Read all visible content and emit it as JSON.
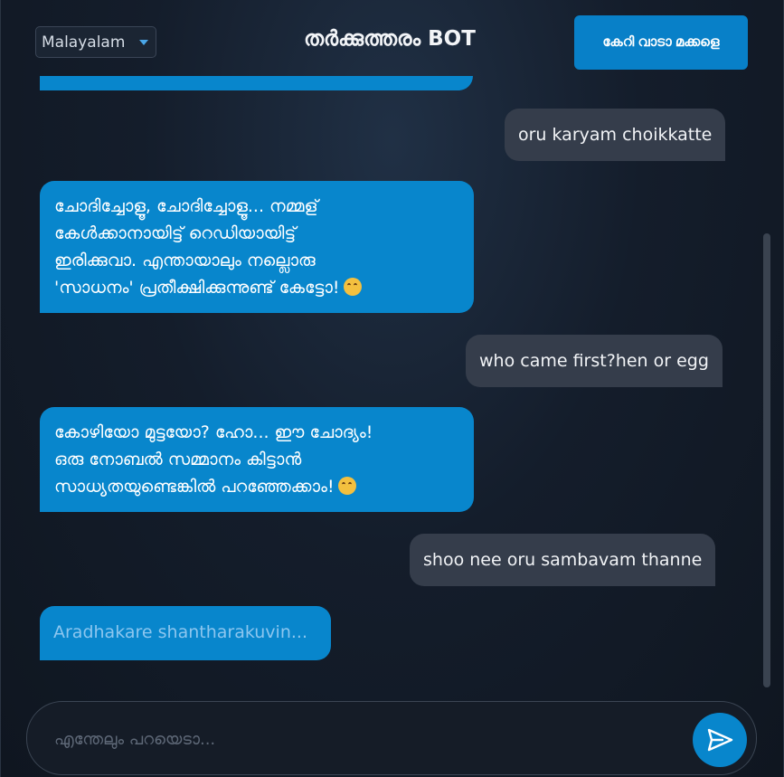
{
  "header": {
    "language": "Malayalam",
    "title": "തർക്കുത്തരം BOT",
    "action_button": "കേറി വാടാ മക്കളെ"
  },
  "messages": [
    {
      "role": "user",
      "text": "oru karyam choikkatte"
    },
    {
      "role": "bot",
      "lines": [
        "ചോദിച്ചോളൂ, ചോദിച്ചോളൂ... നമ്മള്",
        "കേൾക്കാനായിട്ട് റെഡിയായിട്ട്",
        "ഇരിക്കുവാ. എന്തായാലും നല്ലൊരു",
        "'സാധനം' പ്രതീക്ഷിക്കുന്നുണ്ട് കേട്ടോ!"
      ],
      "emoji": "smiling-face-icon"
    },
    {
      "role": "user",
      "text": "who came first?hen or egg"
    },
    {
      "role": "bot",
      "lines": [
        "കോഴിയോ മുട്ടയോ? ഹോ... ഈ ചോദ്യം!",
        "ഒരു നോബൽ സമ്മാനം കിട്ടാൻ",
        "സാധ്യതയുണ്ടെങ്കിൽ പറഞ്ഞേക്കാം!"
      ],
      "emoji": "smirking-face-icon"
    },
    {
      "role": "user",
      "text": "shoo nee oru sambavam thanne"
    },
    {
      "role": "bot",
      "typing": "Aradhakare shantharakuvin..."
    }
  ],
  "input": {
    "placeholder": "എന്തേലും പറയെടാ...",
    "value": ""
  },
  "icons": {
    "send": "send-icon",
    "dropdown": "chevron-down-icon"
  },
  "colors": {
    "accent": "#0886cc",
    "user_bubble": "#353d4b",
    "background": "#141d2b"
  }
}
